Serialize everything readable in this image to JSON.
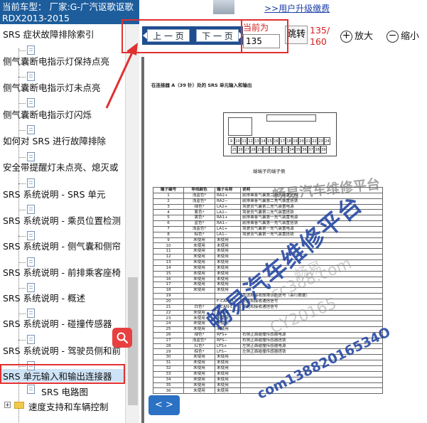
{
  "sidebar": {
    "car_header": "当前车型：  厂家:G-广汽讴歌讴歌RDX2013-2015",
    "items": [
      {
        "label": "SRS 症状故障排除索引"
      },
      {
        "label": "侧气囊断电指示灯保持点亮"
      },
      {
        "label": "侧气囊断电指示灯未点亮"
      },
      {
        "label": "侧气囊断电指示灯闪烁"
      },
      {
        "label": "如何对 SRS 进行故障排除"
      },
      {
        "label": "安全带提醒灯未点亮、熄灭或"
      },
      {
        "label": "SRS 系统说明 - SRS 单元"
      },
      {
        "label": "SRS 系统说明 - 乘员位置检测"
      },
      {
        "label": "SRS 系统说明 - 侧气囊和侧帘"
      },
      {
        "label": "SRS 系统说明 - 前排乘客座椅"
      },
      {
        "label": "SRS 系统说明 - 概述"
      },
      {
        "label": "SRS 系统说明 - 碰撞传感器"
      },
      {
        "label": "SRS 系统说明 - 驾驶员侧和前"
      },
      {
        "label": "SRS 单元输入和输出连接器"
      },
      {
        "label": "SRS 电路图"
      },
      {
        "label": "速度支持和车辆控制"
      }
    ],
    "selected_index": 13
  },
  "banner": {
    "link_text": ">>用户升级缴费"
  },
  "toolbar": {
    "prev_label": "上 一 页",
    "next_label": "下 一 页",
    "current_label": "当前为",
    "page_value": "135",
    "go_label": "跳转",
    "page_count": "135/\n160",
    "zoom_in_label": "放大",
    "zoom_out_label": "缩小"
  },
  "document": {
    "title": "在连接器 A（39 针）处的 SRS 单元输入和输出",
    "connector_caption": "端端子的端子侧",
    "pins_row1": [
      "9",
      "10",
      "11",
      "12",
      "13",
      "14",
      "15",
      "16",
      "17",
      "18",
      "19",
      "20",
      "21",
      "22",
      "23",
      "24"
    ],
    "pins_row2": [
      "25",
      "26",
      "27",
      "28",
      "29",
      "30",
      "31",
      "32",
      "33",
      "34",
      "35",
      "36",
      "37",
      "38",
      "39"
    ],
    "table_headers": [
      "端子编号",
      "导线颜色",
      "端子名称",
      "说明"
    ],
    "table_rows": [
      [
        "1",
        "浅蓝色*",
        "RA2+",
        "前排乘客气囊第二充气装置正极"
      ],
      [
        "2",
        "浅蓝色*",
        "RA2−",
        "前排乘客气囊第二充气装置搭铁"
      ],
      [
        "3",
        "绿色*",
        "LA2+",
        "驾驶员气囊第二充气装置电源"
      ],
      [
        "4",
        "紫色*",
        "LA2−",
        "驾驶员气囊第二充气装置搭铁"
      ],
      [
        "5",
        "黄色*",
        "RA1+",
        "前排乘客气囊第一充气装置电源"
      ],
      [
        "6",
        "蓝色*",
        "RA1−",
        "前排乘客气囊第一充气装置搭铁"
      ],
      [
        "7",
        "浅蓝色*",
        "LA1+",
        "驾驶员气囊第一充气装置电源"
      ],
      [
        "8",
        "棕色*",
        "LA1−",
        "驾驶员气囊第一充气装置搭铁"
      ],
      [
        "9",
        "未使用",
        "未使用",
        ""
      ],
      [
        "10",
        "未使用",
        "未使用",
        ""
      ],
      [
        "11",
        "未使用",
        "未使用",
        ""
      ],
      [
        "12",
        "未使用",
        "未使用",
        ""
      ],
      [
        "13",
        "未使用",
        "未使用",
        ""
      ],
      [
        "14",
        "未使用",
        "未使用",
        ""
      ],
      [
        "15",
        "未使用",
        "未使用",
        ""
      ],
      [
        "16",
        "未使用",
        "未使用",
        ""
      ],
      [
        "17",
        "未使用",
        "未使用",
        ""
      ],
      [
        "18",
        "未使用",
        "未使用",
        ""
      ],
      [
        "19",
        "",
        "",
        "发送和接收故障诊断信号（串行数据）"
      ],
      [
        "20",
        "",
        "F-CAN-H",
        "发送和接收通信信号"
      ],
      [
        "21",
        "白色*",
        "F-CAN-L",
        "发送和接收通信信号"
      ],
      [
        "22",
        "未使用",
        "未使用",
        ""
      ],
      [
        "23",
        "未使用",
        "未使用",
        ""
      ],
      [
        "24",
        "未使用",
        "未使用",
        ""
      ],
      [
        "25",
        "未使用",
        "未使用",
        ""
      ],
      [
        "26",
        "绿色*",
        "RFS+",
        "右侧正面碰撞传感器电源"
      ],
      [
        "27",
        "浅蓝色*",
        "RFS−",
        "右侧正面碰撞传感器搭铁"
      ],
      [
        "28",
        "红色*",
        "LFS+",
        "左侧正面碰撞传感器电源"
      ],
      [
        "29",
        "棕色*",
        "LFS−",
        "左侧正面碰撞传感器搭铁"
      ],
      [
        "30",
        "未使用",
        "未使用",
        ""
      ],
      [
        "31",
        "未使用",
        "未使用",
        ""
      ],
      [
        "32",
        "未使用",
        "未使用",
        ""
      ],
      [
        "33",
        "未使用",
        "未使用",
        ""
      ],
      [
        "34",
        "未使用",
        "未使用",
        ""
      ],
      [
        "35",
        "未使用",
        "未使用",
        ""
      ],
      [
        "36",
        "未使用",
        "未使用",
        ""
      ]
    ],
    "watermark_main": "畅易汽车维修平台",
    "watermark_top": "畅易汽车维修平台",
    "watermark_url": "cc388.com",
    "watermark_code": "CY20165",
    "watermark_phone": "com13882016534O",
    "watermark_faint": "畅易"
  },
  "pager": {
    "label": "< >"
  },
  "colors": {
    "header_bg": "#1d5d9c",
    "nav_bg": "#1f4e8f",
    "highlight": "#e03030",
    "watermark_blue": "#1b3f9e",
    "fab": "#e84040"
  }
}
